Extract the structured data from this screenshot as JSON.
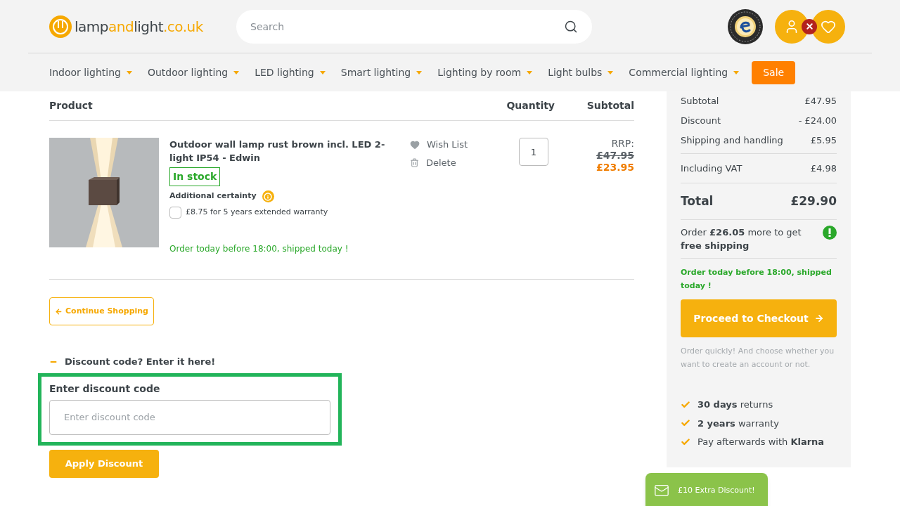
{
  "logo": {
    "parts": [
      {
        "text": "lamp",
        "accent": false
      },
      {
        "text": "and",
        "accent": true
      },
      {
        "text": "light",
        "accent": false
      },
      {
        "text": ".co.uk",
        "accent": true
      }
    ]
  },
  "search": {
    "placeholder": "Search"
  },
  "nav": [
    {
      "label": "Indoor lighting",
      "kind": "menu"
    },
    {
      "label": "Outdoor lighting",
      "kind": "menu"
    },
    {
      "label": "LED lighting",
      "kind": "menu"
    },
    {
      "label": "Smart lighting",
      "kind": "menu"
    },
    {
      "label": "Lighting by room",
      "kind": "menu"
    },
    {
      "label": "Light bulbs",
      "kind": "menu"
    },
    {
      "label": "Commercial lighting",
      "kind": "menu"
    },
    {
      "label": "Sale",
      "kind": "sale"
    }
  ],
  "cart": {
    "columns": [
      "Product",
      "Quantity",
      "Subtotal"
    ],
    "item": {
      "title": "Outdoor wall lamp rust brown incl. LED 2-light IP54 - Edwin",
      "stock": "In stock",
      "certainty": "Additional certainty",
      "warranty": {
        "label": "£8.75 for 5 years extended warranty",
        "checked": false
      },
      "delivery": "Order today before 18:00, shipped today !",
      "actions": [
        {
          "label": "Wish List",
          "kind": "wish"
        },
        {
          "label": "Delete",
          "kind": "delete"
        }
      ],
      "quantity": "1",
      "rrp_label": "RRP:",
      "rrp": "£47.95",
      "price": "£23.95"
    }
  },
  "continue_button": "Continue Shopping",
  "discount": {
    "toggle": "Discount code? Enter it here!",
    "expanded": true,
    "label": "Enter discount code",
    "placeholder": "Enter discount code",
    "button": "Apply Discount"
  },
  "summary": {
    "rows": [
      {
        "label": "Subtotal",
        "value": "£47.95"
      },
      {
        "label": "Discount",
        "value": "- £24.00"
      },
      {
        "label": "Shipping and handling",
        "value": "£5.95"
      }
    ],
    "vat": {
      "label": "Including VAT",
      "value": "£4.98"
    },
    "total": {
      "label": "Total",
      "value": "£29.90"
    },
    "free_shipping": "Order **£26.05** more to get **free shipping**",
    "delivery": "Order today before 18:00, shipped today !",
    "checkout": "Proceed to Checkout",
    "note": "Order quickly! And choose whether you want to create an account or not.",
    "usps": [
      "**30 days** returns",
      "**2 years** warranty",
      "Pay afterwards with **Klarna**"
    ]
  },
  "promo": "£10 Extra Discount!"
}
